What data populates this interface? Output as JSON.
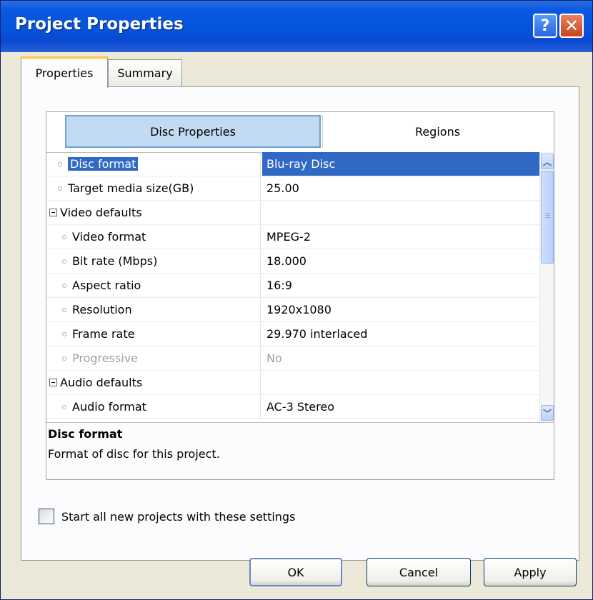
{
  "window": {
    "title": "Project Properties",
    "help_glyph": "?",
    "close_glyph": "✕"
  },
  "tabs": [
    {
      "label": "Properties",
      "active": true
    },
    {
      "label": "Summary",
      "active": false
    }
  ],
  "property_tabs": [
    {
      "label": "Disc Properties",
      "active": true
    },
    {
      "label": "Regions",
      "active": false
    }
  ],
  "rows": [
    {
      "name": "Disc format",
      "value": "Blu-ray Disc",
      "selected": true
    },
    {
      "name": "Target media size(GB)",
      "value": "25.00"
    },
    {
      "name": "Video defaults",
      "value": "",
      "group": true
    },
    {
      "name": "Video format",
      "value": "MPEG-2"
    },
    {
      "name": "Bit rate (Mbps)",
      "value": "18.000"
    },
    {
      "name": "Aspect ratio",
      "value": "16:9"
    },
    {
      "name": "Resolution",
      "value": "1920x1080"
    },
    {
      "name": "Frame rate",
      "value": "29.970 interlaced"
    },
    {
      "name": "Progressive",
      "value": "No",
      "disabled": true
    },
    {
      "name": "Audio defaults",
      "value": "",
      "group": true
    },
    {
      "name": "Audio format",
      "value": "AC-3 Stereo"
    }
  ],
  "description": {
    "title": "Disc format",
    "text": "Format of disc for this project."
  },
  "checkbox": {
    "label": "Start all new projects with these settings",
    "checked": false
  },
  "buttons": {
    "ok": "OK",
    "cancel": "Cancel",
    "apply": "Apply"
  },
  "colors": {
    "titlebar": "#0554de",
    "selection": "#316ac5",
    "dialog_bg": "#ece9d8",
    "active_tab_highlight": "#ffc83c"
  }
}
